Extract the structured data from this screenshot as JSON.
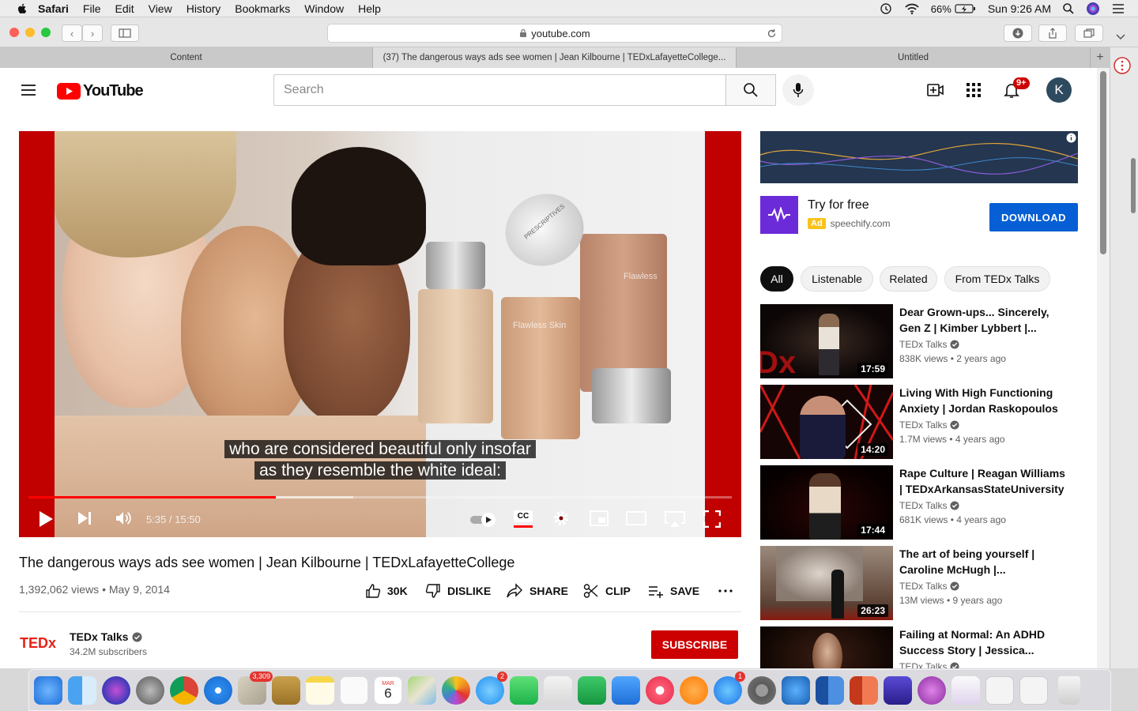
{
  "menubar": {
    "app": "Safari",
    "items": [
      "File",
      "Edit",
      "View",
      "History",
      "Bookmarks",
      "Window",
      "Help"
    ],
    "battery": "66%",
    "clock": "Sun 9:26 AM"
  },
  "browser": {
    "url": "youtube.com",
    "tabs": [
      {
        "title": "Content"
      },
      {
        "title": "(37) The dangerous ways ads see women | Jean Kilbourne | TEDxLafayetteCollege..."
      },
      {
        "title": "Untitled"
      }
    ]
  },
  "youtube": {
    "logo_text": "YouTube",
    "search_placeholder": "Search",
    "notif_badge": "9+",
    "avatar_letter": "K"
  },
  "player": {
    "caption_line1": "who are considered beautiful only insofar",
    "caption_line2": "as they resemble the white ideal:",
    "time": "5:35 / 15:50",
    "progress_fraction": 0.352,
    "buffered_fraction": 0.462,
    "cc_label": "CC",
    "jar_text_1": "Flawless Skin",
    "jar_text_2": "Flawless",
    "jar_brand": "PRESCRIPTIVES"
  },
  "video": {
    "title": "The dangerous ways ads see women | Jean Kilbourne | TEDxLafayetteCollege",
    "meta": "1,392,062 views • May 9, 2014",
    "actions": {
      "like": "30K",
      "dislike": "DISLIKE",
      "share": "SHARE",
      "clip": "CLIP",
      "save": "SAVE"
    },
    "channel": {
      "logo": "TEDx",
      "name": "TEDx Talks",
      "subscribers": "34.2M subscribers",
      "subscribe_label": "SUBSCRIBE"
    }
  },
  "ad": {
    "title": "Try for free",
    "badge": "Ad",
    "domain": "speechify.com",
    "button": "DOWNLOAD"
  },
  "chips": [
    "All",
    "Listenable",
    "Related",
    "From TEDx Talks"
  ],
  "recommendations": [
    {
      "title": "Dear Grown-ups... Sincerely, Gen Z | Kimber Lybbert |...",
      "channel": "TEDx Talks",
      "meta": "838K views • 2 years ago",
      "duration": "17:59"
    },
    {
      "title": "Living With High Functioning Anxiety | Jordan Raskopoulos ...",
      "channel": "TEDx Talks",
      "meta": "1.7M views • 4 years ago",
      "duration": "14:20"
    },
    {
      "title": "Rape Culture | Reagan Williams | TEDxArkansasStateUniversity",
      "channel": "TEDx Talks",
      "meta": "681K views • 4 years ago",
      "duration": "17:44"
    },
    {
      "title": "The art of being yourself | Caroline McHugh |...",
      "channel": "TEDx Talks",
      "meta": "13M views • 9 years ago",
      "duration": "26:23"
    },
    {
      "title": "Failing at Normal: An ADHD Success Story | Jessica...",
      "channel": "TEDx Talks",
      "meta": "",
      "duration": ""
    }
  ],
  "dock": {
    "mail_badge": "3,309",
    "messages_badge": "2",
    "appstore_badge": "1",
    "calendar_month": "MAR",
    "calendar_day": "6"
  }
}
